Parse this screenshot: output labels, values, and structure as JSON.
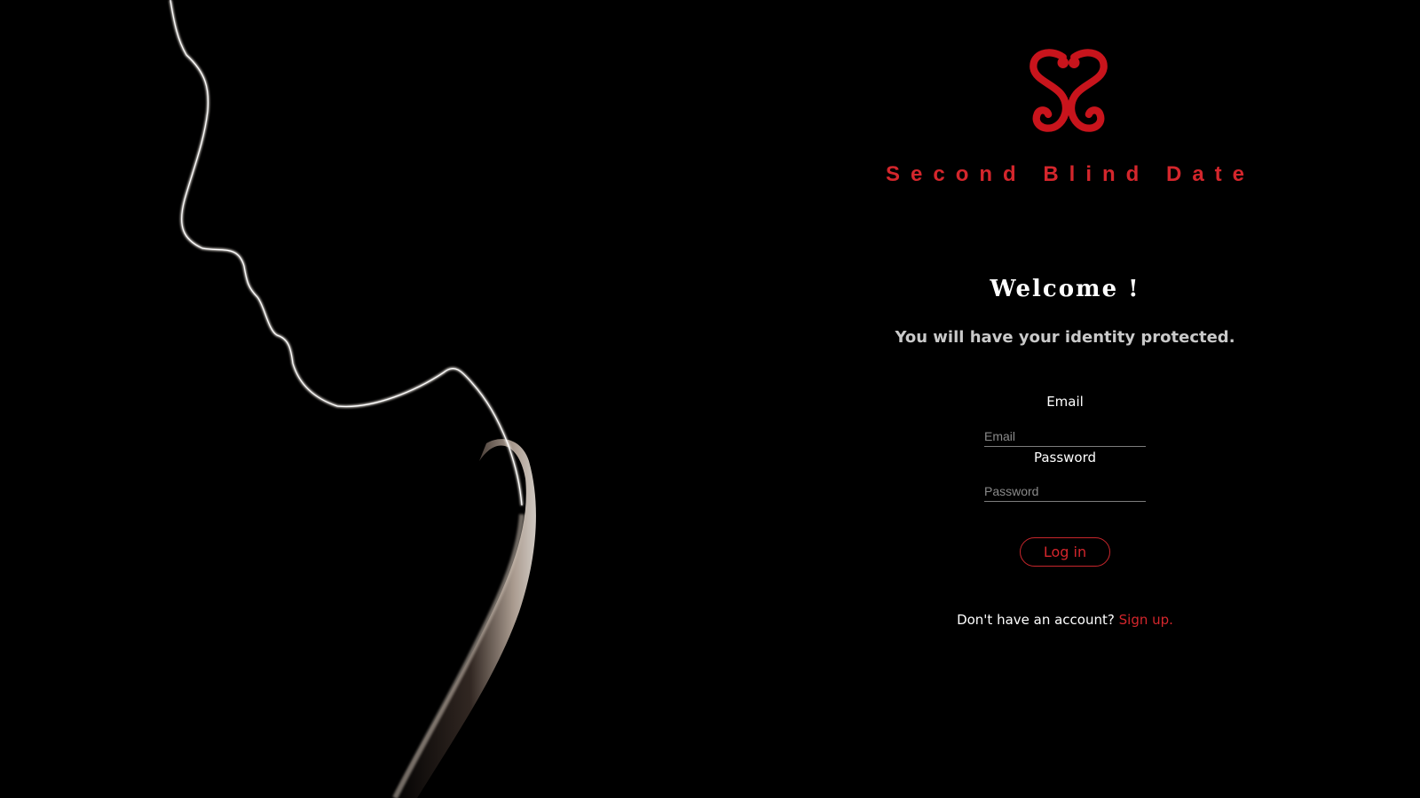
{
  "hero": {
    "image": "backlit-face-silhouette",
    "colors": {
      "background": "#000000",
      "rim_light": "#f2ece4"
    }
  },
  "brand": {
    "logo_icon": "double-s-heart-logo",
    "name": "Second Blind Date",
    "color": "#d4262c"
  },
  "welcome": {
    "heading": "Welcome !",
    "tagline": "You will have your identity protected."
  },
  "form": {
    "email_label": "Email",
    "email_placeholder": "Email",
    "email_value": "",
    "password_label": "Password",
    "password_placeholder": "Password",
    "password_value": "",
    "login_label": "Log in"
  },
  "signup": {
    "prompt": "Don't have an account?",
    "link_label": "Sign up."
  }
}
